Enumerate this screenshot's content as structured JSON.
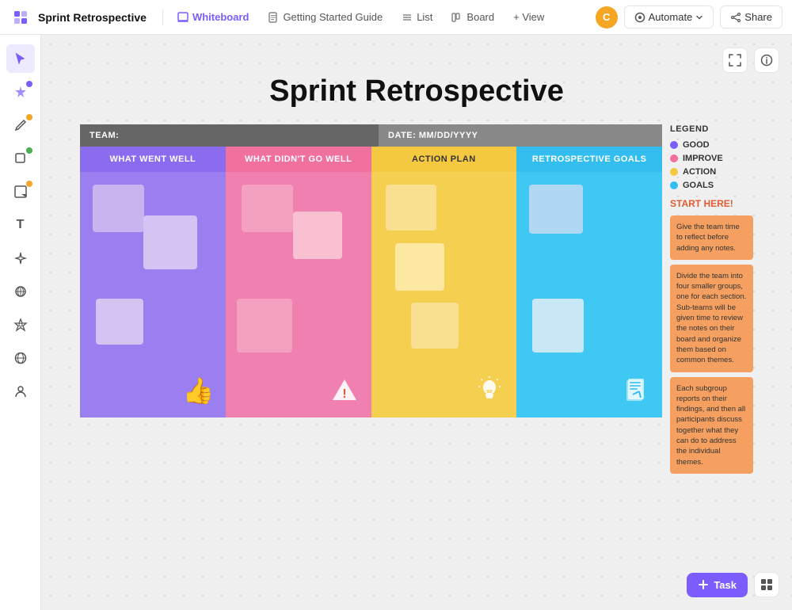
{
  "nav": {
    "app_title": "Sprint Retrospective",
    "tabs": [
      {
        "label": "Whiteboard",
        "active": true
      },
      {
        "label": "Getting Started Guide",
        "active": false
      },
      {
        "label": "List",
        "active": false
      },
      {
        "label": "Board",
        "active": false
      },
      {
        "label": "+ View",
        "active": false
      }
    ],
    "automate_label": "Automate",
    "share_label": "Share",
    "avatar_initials": "C"
  },
  "sidebar": {
    "tools": [
      {
        "name": "cursor",
        "icon": "↖",
        "active": true,
        "dot": null
      },
      {
        "name": "magic",
        "icon": "✦",
        "active": false,
        "dot": "purple"
      },
      {
        "name": "pen",
        "icon": "✏",
        "active": false,
        "dot": "orange"
      },
      {
        "name": "shapes",
        "icon": "□",
        "active": false,
        "dot": "green"
      },
      {
        "name": "sticky",
        "icon": "🗒",
        "active": false,
        "dot": "orange"
      },
      {
        "name": "text",
        "icon": "T",
        "active": false,
        "dot": null
      },
      {
        "name": "magic2",
        "icon": "⚡",
        "active": false,
        "dot": null
      },
      {
        "name": "connect",
        "icon": "⊕",
        "active": false,
        "dot": null
      },
      {
        "name": "star",
        "icon": "✱",
        "active": false,
        "dot": null
      },
      {
        "name": "globe",
        "icon": "🌐",
        "active": false,
        "dot": null
      },
      {
        "name": "person",
        "icon": "👤",
        "active": false,
        "dot": null
      }
    ]
  },
  "board": {
    "title": "Sprint Retrospective",
    "team_label": "TEAM:",
    "date_label": "DATE: MM/DD/YYYY",
    "columns": [
      {
        "label": "WHAT WENT WELL",
        "color": "purple"
      },
      {
        "label": "WHAT DIDN'T GO WELL",
        "color": "pink"
      },
      {
        "label": "ACTION PLAN",
        "color": "yellow"
      },
      {
        "label": "RETROSPECTIVE GOALS",
        "color": "blue"
      }
    ],
    "column_icons": [
      "👍",
      "⚠",
      "💡",
      "📋"
    ]
  },
  "legend": {
    "title": "LEGEND",
    "items": [
      {
        "color": "#7c5cfc",
        "label": "GOOD"
      },
      {
        "color": "#f070a0",
        "label": "IMPROVE"
      },
      {
        "color": "#f5c842",
        "label": "ACTION"
      },
      {
        "color": "#34bef0",
        "label": "GOALS"
      }
    ],
    "start_here": "START HERE!",
    "instructions": [
      "Give the team time to reflect before adding any notes.",
      "Divide the team into four smaller groups, one for each section. Sub-teams will be given time to review the notes on their board and organize them based on common themes.",
      "Each subgroup reports on their findings, and then all participants discuss together what they can do to address the individual themes."
    ]
  },
  "footer": {
    "task_label": "Task"
  }
}
